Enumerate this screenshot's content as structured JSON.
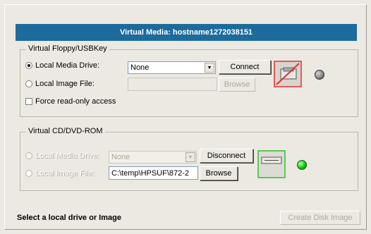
{
  "title": "Virtual Media: hostname1272038151",
  "floppy": {
    "legend": "Virtual Floppy/USBKey",
    "local_media_drive_label": "Local Media Drive:",
    "local_media_drive_value": "None",
    "connect_label": "Connect",
    "local_image_file_label": "Local Image File:",
    "local_image_file_value": "",
    "browse_label": "Browse",
    "force_readonly_label": "Force read-only access",
    "status_color": "#7f7f7f"
  },
  "cdrom": {
    "legend": "Virtual CD/DVD-ROM",
    "local_media_drive_label": "Local Media Drive:",
    "local_media_drive_value": "None",
    "disconnect_label": "Disconnect",
    "local_image_file_label": "Local Image File:",
    "local_image_file_value": "C:\\temp\\HPSUF\\872-2",
    "browse_label": "Browse",
    "status_color": "#00c000"
  },
  "status_text": "Select a local drive or Image",
  "create_disk_image_label": "Create Disk Image"
}
